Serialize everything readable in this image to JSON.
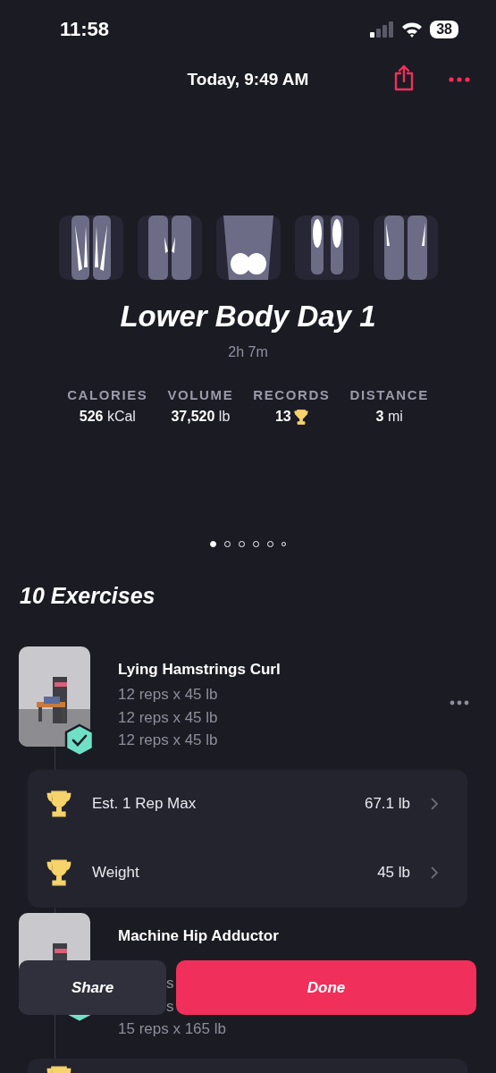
{
  "status_bar": {
    "time": "11:58",
    "battery": "38"
  },
  "header": {
    "title": "Today, 9:49 AM"
  },
  "muscle_maps": [
    {
      "kind": "hamstrings"
    },
    {
      "kind": "adductors"
    },
    {
      "kind": "glutes"
    },
    {
      "kind": "calves"
    },
    {
      "kind": "quadriceps"
    }
  ],
  "workout": {
    "title": "Lower Body Day 1",
    "duration": "2h 7m"
  },
  "stats": [
    {
      "label": "CALORIES",
      "value": "526",
      "unit": "kCal",
      "kind": "unit"
    },
    {
      "label": "VOLUME",
      "value": "37,520",
      "unit": "lb",
      "kind": "unit"
    },
    {
      "label": "RECORDS",
      "value": "13",
      "kind": "trophy"
    },
    {
      "label": "DISTANCE",
      "value": "3",
      "unit": "mi",
      "kind": "unit"
    }
  ],
  "pages": [
    {
      "selected": true,
      "kind": "page"
    },
    {
      "selected": false,
      "kind": "page"
    },
    {
      "selected": false,
      "kind": "page"
    },
    {
      "selected": false,
      "kind": "page"
    },
    {
      "selected": false,
      "kind": "page"
    },
    {
      "selected": false,
      "kind": "more"
    }
  ],
  "exercises_heading": "10 Exercises",
  "exercises": [
    {
      "name": "Lying Hamstrings Curl",
      "done": true,
      "sets": [
        {
          "kind": "full",
          "text": "12 reps x 45 lb"
        },
        {
          "kind": "full",
          "text": "12 reps x 45 lb"
        },
        {
          "kind": "full",
          "text": "12 reps x 45 lb"
        }
      ],
      "records": [
        {
          "kind": "full",
          "label": "Est. 1 Rep Max",
          "value": "67.1 lb"
        },
        {
          "kind": "full",
          "label": "Weight",
          "value": "45 lb"
        }
      ]
    },
    {
      "name": "Machine Hip Adductor",
      "done": true,
      "sets": [
        {
          "kind": "covered"
        },
        {
          "kind": "fragment",
          "text": "s"
        },
        {
          "kind": "fragment",
          "text": "s"
        },
        {
          "kind": "full",
          "text": "15 reps x 165 lb"
        }
      ],
      "records": [
        {
          "kind": "partial"
        }
      ]
    }
  ],
  "actions": [
    {
      "label": "Share",
      "kind": "secondary"
    },
    {
      "label": "Done",
      "kind": "primary"
    }
  ]
}
